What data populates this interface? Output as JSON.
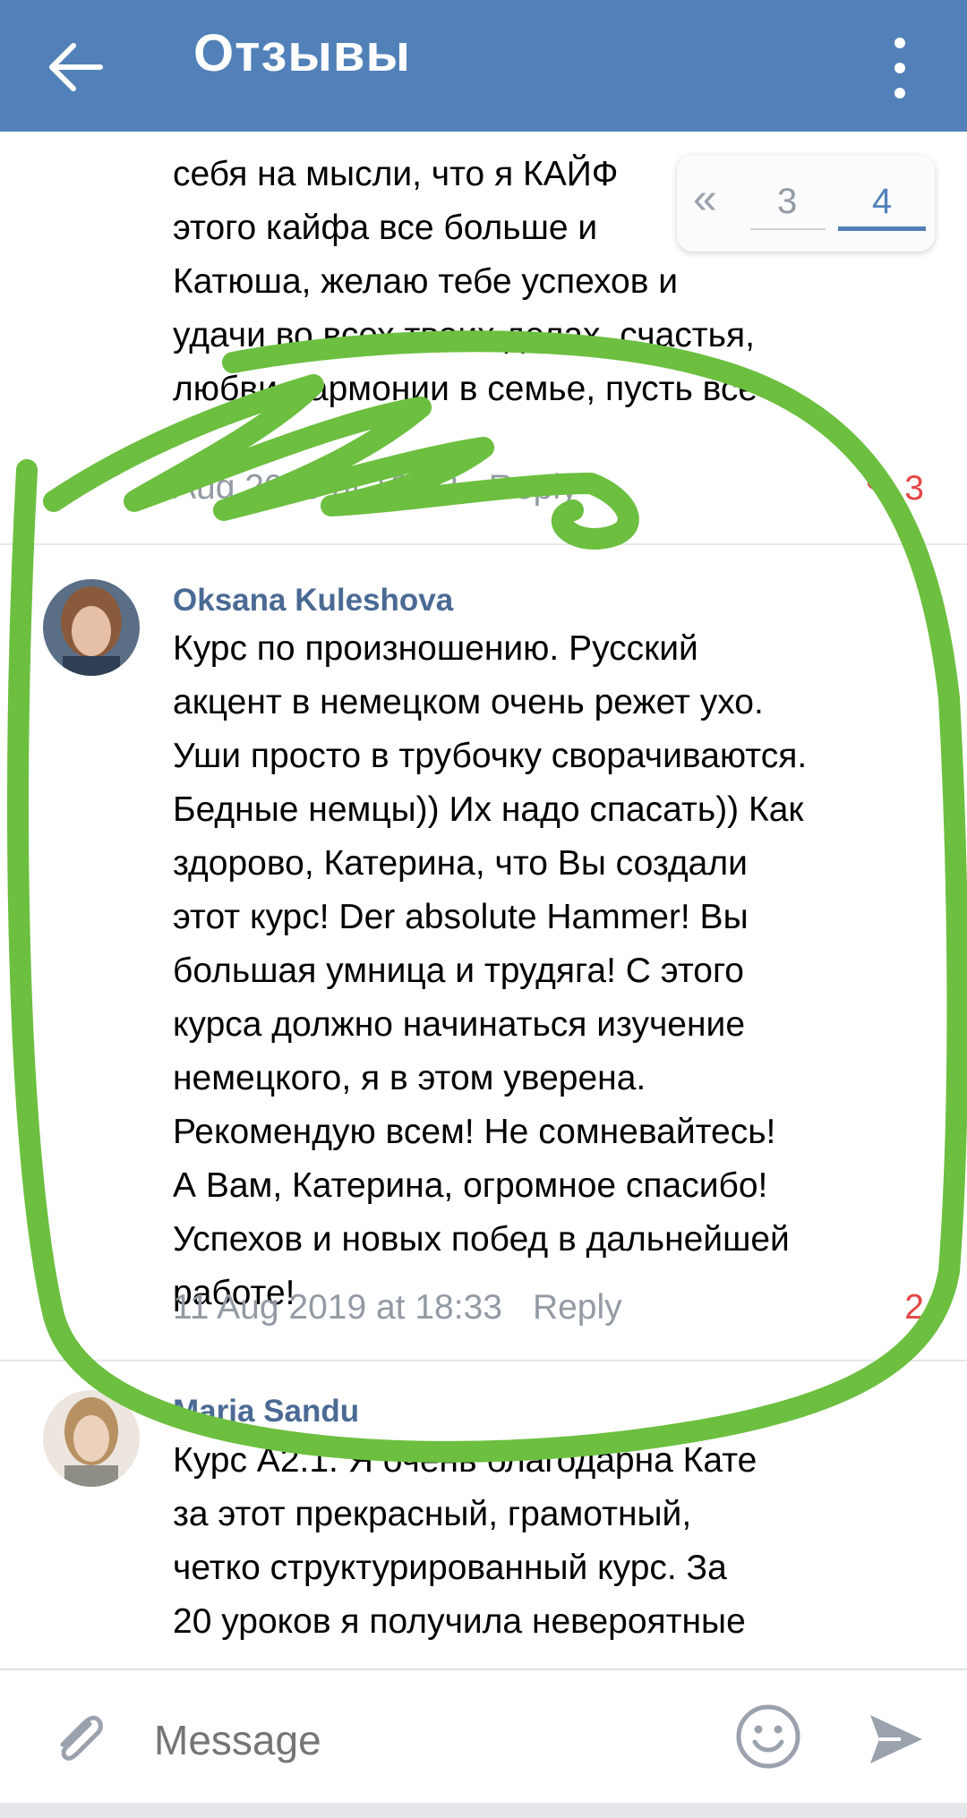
{
  "header": {
    "title": "Отзывы",
    "back_icon": "arrow-left-icon",
    "menu_icon": "more-vertical-icon",
    "bg_color": "#5181b8"
  },
  "pager": {
    "prev_label": "«",
    "pages": [
      "3",
      "4"
    ],
    "active_page": "4"
  },
  "comments": [
    {
      "text_partial": "себя на мысли, что я КАЙФ\nэтого кайфа все больше и\nКатюша, желаю тебе успехов и\nудачи во всех твоих делах, счастья,\nлюбви, гармонии в семье, пусть все",
      "date": "Aug 2019 at 10:03",
      "reply": "Reply",
      "likes": "3"
    },
    {
      "author": "Oksana Kuleshova",
      "text": "Курс по произношению. Русский\nакцент в немецком очень режет ухо.\nУши просто в трубочку сворачиваются.\nБедные немцы)) Их надо спасать)) Как\nздорово, Катерина, что Вы создали\nэтот курс! Der absolute Hammer! Вы\nбольшая умница и трудяга! С этого\nкурса должно начинаться изучение\nнемецкого, я в этом уверена.\nРекомендую всем! Не сомневайтесь!\nА Вам, Катерина, огромное спасибо!\nУспехов и новых побед в дальнейшей\nработе!",
      "date": "11 Aug 2019 at 18:33",
      "reply": "Reply",
      "likes": "2"
    },
    {
      "author": "Maria Sandu",
      "text": "Курс А2.1. Я очень благодарна Кате\nза этот прекрасный, грамотный,\nчетко структурированный курс. За\n20 уроков я получила невероятные"
    }
  ],
  "composer": {
    "placeholder": "Message",
    "attach_icon": "paperclip-icon",
    "emoji_icon": "smile-icon",
    "send_icon": "send-icon"
  },
  "colors": {
    "accent": "#5181b8",
    "like": "#e64646",
    "author": "#4a6a94",
    "meta": "#939aa4",
    "highlight_stroke": "#6cbf3f"
  }
}
